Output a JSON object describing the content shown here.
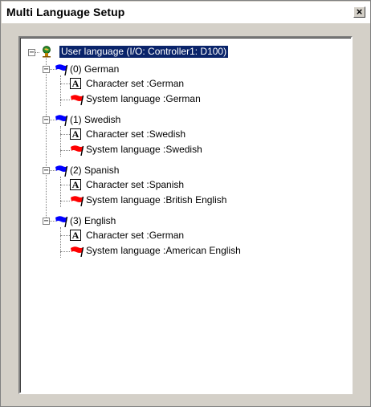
{
  "window": {
    "title": "Multi Language Setup"
  },
  "tree": {
    "root": {
      "label": "User language (I/O: Controller1: D100)",
      "icon": "globe-user-icon",
      "expanded": true,
      "selected": true
    },
    "languages": [
      {
        "label": "(0) German",
        "flag_color": "#0000ff",
        "children": [
          {
            "label": "Character set :German",
            "icon": "character-set-icon"
          },
          {
            "label": "System language :German",
            "icon": "red-flag-icon"
          }
        ]
      },
      {
        "label": "(1) Swedish",
        "flag_color": "#0000ff",
        "children": [
          {
            "label": "Character set :Swedish",
            "icon": "character-set-icon"
          },
          {
            "label": "System language :Swedish",
            "icon": "red-flag-icon"
          }
        ]
      },
      {
        "label": "(2) Spanish",
        "flag_color": "#0000ff",
        "children": [
          {
            "label": "Character set :Spanish",
            "icon": "character-set-icon"
          },
          {
            "label": "System language :British English",
            "icon": "red-flag-icon"
          }
        ]
      },
      {
        "label": "(3) English",
        "flag_color": "#0000ff",
        "children": [
          {
            "label": "Character set :German",
            "icon": "character-set-icon"
          },
          {
            "label": "System language :American English",
            "icon": "red-flag-icon"
          }
        ]
      }
    ]
  },
  "colors": {
    "selection": "#0a246a",
    "blue_flag": "#0000ff",
    "red_flag": "#ff0000",
    "background": "#d4d0c8"
  },
  "expander_symbols": {
    "expanded": "−"
  },
  "char_icon_glyph": "A"
}
